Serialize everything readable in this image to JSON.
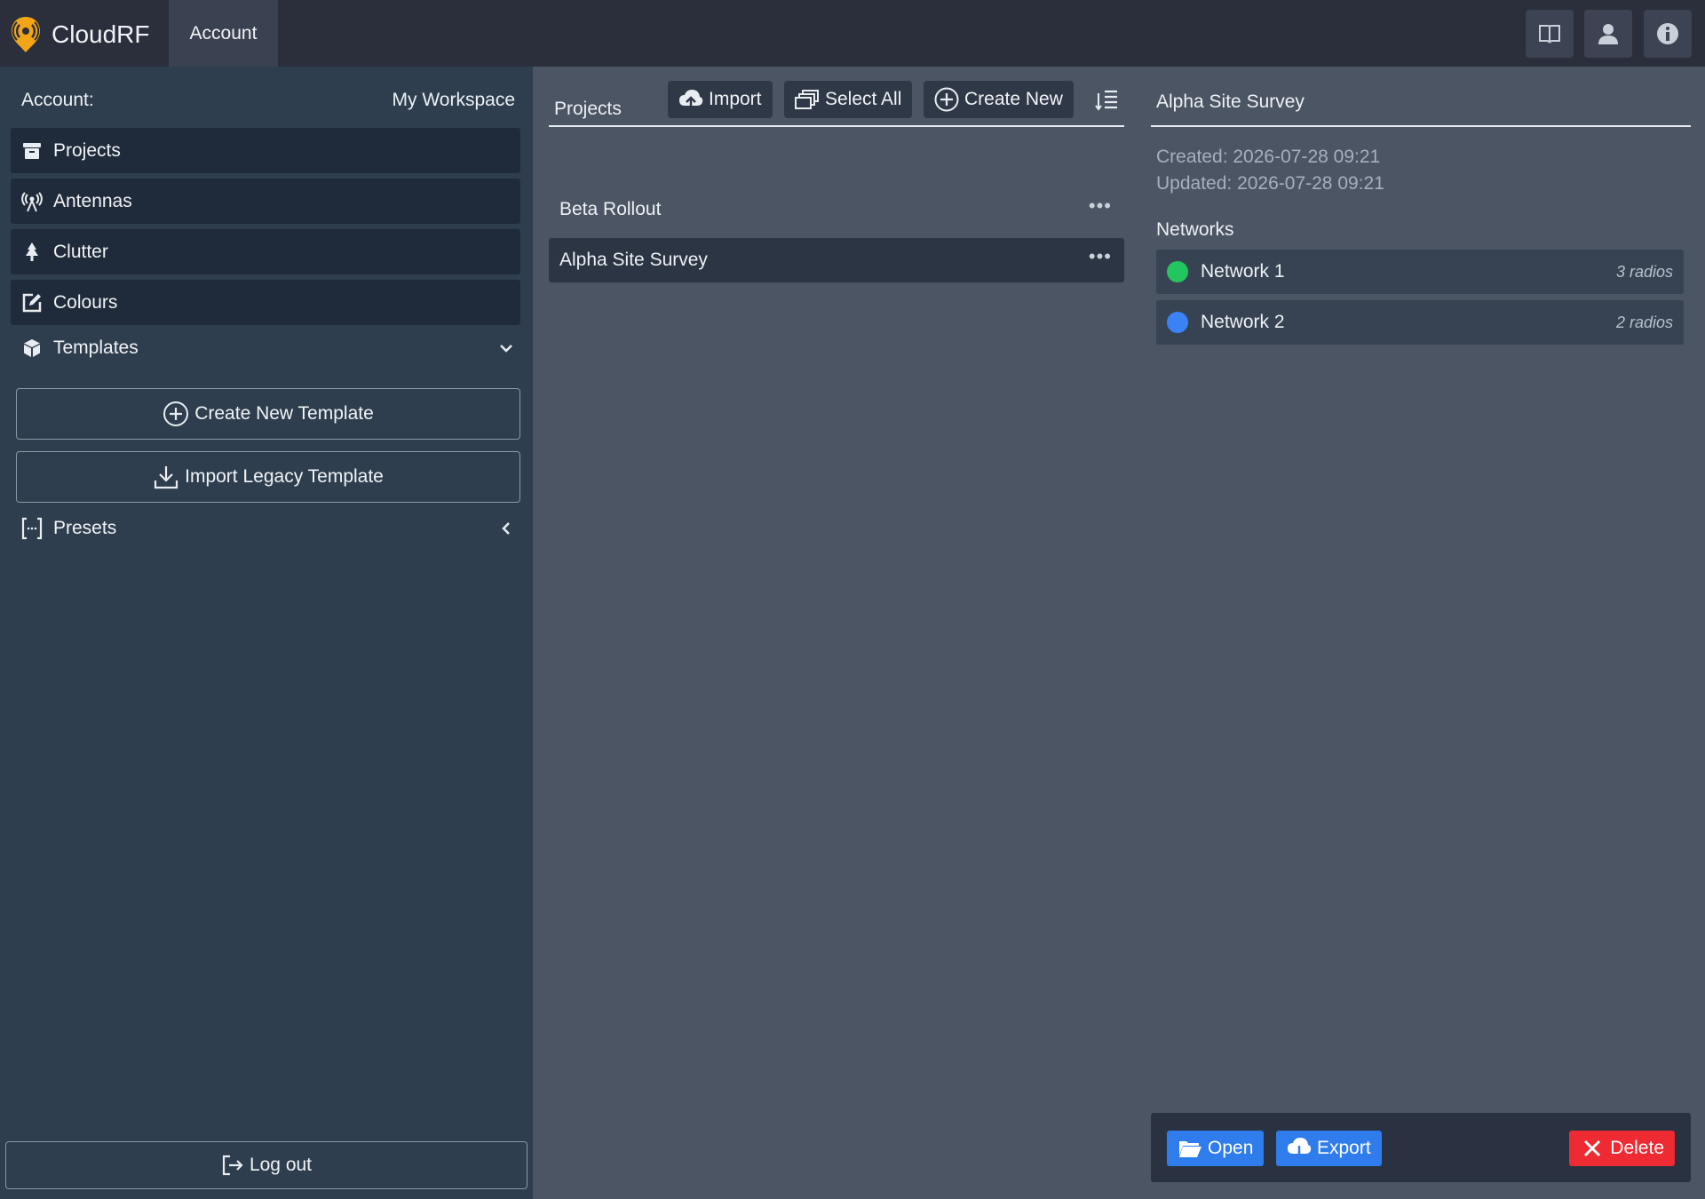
{
  "app": {
    "name": "CloudRF",
    "active_tab": "Account",
    "colors": {
      "topbar": "#2a2f3b",
      "accent_orange": "#f2a516",
      "primary_blue": "#2f7ded",
      "danger_red": "#ee2a32"
    }
  },
  "topbar": {
    "buttons": [
      {
        "icon": "book-icon"
      },
      {
        "icon": "user-icon"
      },
      {
        "icon": "info-icon"
      }
    ]
  },
  "sidebar": {
    "account_label": "Account:",
    "workspace": "My Workspace",
    "items": [
      {
        "label": "Projects",
        "icon": "archive-icon"
      },
      {
        "label": "Antennas",
        "icon": "antenna-icon"
      },
      {
        "label": "Clutter",
        "icon": "tree-icon"
      },
      {
        "label": "Colours",
        "icon": "edit-square-icon"
      }
    ],
    "templates": {
      "label": "Templates",
      "icon": "box-icon",
      "expanded": true,
      "create_label": "Create New Template",
      "import_label": "Import Legacy Template"
    },
    "presets": {
      "label": "Presets",
      "icon": "brackets-icon",
      "expanded": false
    },
    "logout_label": "Log out"
  },
  "projects": {
    "title": "Projects",
    "toolbar": {
      "import_label": "Import",
      "select_all_label": "Select All",
      "create_new_label": "Create New"
    },
    "list": [
      {
        "name": "Beta Rollout",
        "selected": false
      },
      {
        "name": "Alpha Site Survey",
        "selected": true
      }
    ],
    "more_glyph": "•••"
  },
  "detail": {
    "title": "Alpha Site Survey",
    "created": "Created: 2026-07-28 09:21",
    "updated": "Updated: 2026-07-28 09:21",
    "networks_label": "Networks",
    "networks": [
      {
        "name": "Network 1",
        "count": "3 radios",
        "color": "#22c55e"
      },
      {
        "name": "Network 2",
        "count": "2 radios",
        "color": "#3b82f6"
      }
    ],
    "actions": {
      "open_label": "Open",
      "export_label": "Export",
      "delete_label": "Delete"
    }
  }
}
